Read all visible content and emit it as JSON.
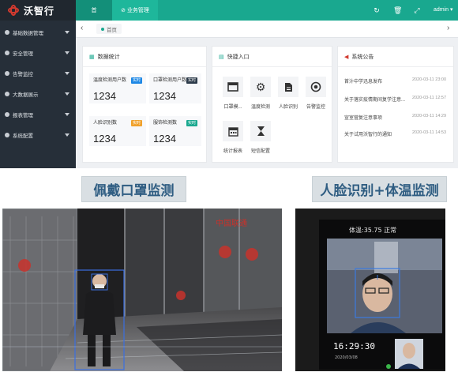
{
  "brand": {
    "name": "沃智行"
  },
  "topbar": {
    "tab_home": "首",
    "tab_business": "业务管理",
    "user": "admin"
  },
  "sidebar": {
    "items": [
      {
        "label": "基础数据管理"
      },
      {
        "label": "安全管理"
      },
      {
        "label": "告警监控"
      },
      {
        "label": "大数据展示"
      },
      {
        "label": "报表管理"
      },
      {
        "label": "系统配置"
      }
    ]
  },
  "breadcrumb": {
    "home": "首页"
  },
  "stats_card": {
    "title": "数据统计",
    "items": [
      {
        "label": "温度检测用户数",
        "badge": "实时",
        "badge_color": "#1e88e5",
        "value": "1234"
      },
      {
        "label": "口罩检测用户数",
        "badge": "实时",
        "badge_color": "#2d3b4a",
        "value": "1234"
      },
      {
        "label": "人脸识别数",
        "badge": "实时",
        "badge_color": "#f0a12b",
        "value": "1234"
      },
      {
        "label": "服饰检测数",
        "badge": "实时",
        "badge_color": "#19a88f",
        "value": "1234"
      }
    ]
  },
  "quick_card": {
    "title": "快捷入口",
    "items": [
      {
        "label": "口罩模...",
        "icon": "window-icon"
      },
      {
        "label": "温度检测",
        "icon": "gears-icon"
      },
      {
        "label": "人脸识别",
        "icon": "document-icon"
      },
      {
        "label": "告警监控",
        "icon": "target-icon"
      },
      {
        "label": "统计报表",
        "icon": "calendar-icon"
      },
      {
        "label": "短信配置",
        "icon": "hourglass-icon"
      }
    ]
  },
  "notice_card": {
    "title": "系统公告",
    "items": [
      {
        "text": "首汁中学迅息发布",
        "date": "2020-03-11 23:00"
      },
      {
        "text": "关于落实疫情期间复学注意...",
        "date": "2020-03-11 12:57"
      },
      {
        "text": "宣室营复注意事项",
        "date": "2020-03-11 14:29"
      },
      {
        "text": "关于试用沃智行的通知",
        "date": "2020-03-11 14:53"
      }
    ]
  },
  "captions": {
    "mask": "佩戴口罩监测",
    "face": "人脸识别+体温监测"
  },
  "face_screen": {
    "temp": "体温:35.75 正常",
    "time": "16:29:30",
    "date": "2020/03/08"
  },
  "colors": {
    "accent": "#19a88f",
    "sidebar": "#262f39",
    "brand_red": "#d23a2f"
  }
}
